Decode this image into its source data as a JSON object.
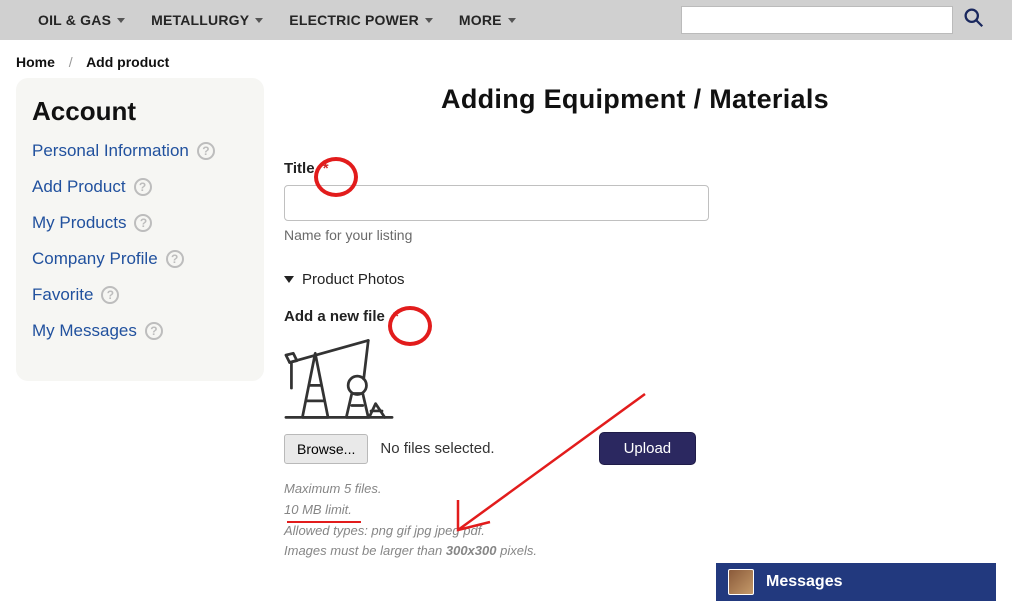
{
  "topnav": {
    "items": [
      "OIL & GAS",
      "METALLURGY",
      "ELECTRIC POWER",
      "MORE"
    ]
  },
  "breadcrumbs": {
    "home": "Home",
    "current": "Add product"
  },
  "sidebar": {
    "title": "Account",
    "items": [
      "Personal Information",
      "Add Product",
      "My Products",
      "Company Profile",
      "Favorite",
      "My Messages"
    ]
  },
  "page": {
    "title": "Adding Equipment / Materials"
  },
  "form": {
    "title_label": "Title",
    "title_help": "Name for your listing",
    "photos_section": "Product Photos",
    "add_file_label": "Add a new file",
    "browse_label": "Browse...",
    "nofiles_text": "No files selected.",
    "upload_label": "Upload",
    "hint1": "Maximum 5 files.",
    "hint2": "10 MB limit.",
    "hint3": "Allowed types: png gif jpg jpeg pdf.",
    "hint4_prefix": "Images must be larger than ",
    "hint4_px": "300x300",
    "hint4_suffix": " pixels."
  },
  "messages_bar": {
    "label": "Messages"
  }
}
